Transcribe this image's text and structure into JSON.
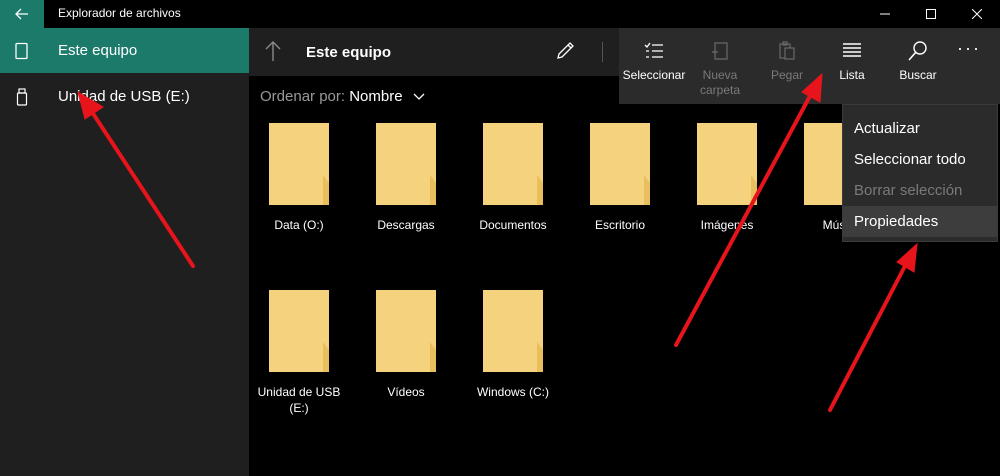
{
  "window": {
    "title": "Explorador de archivos",
    "controls": [
      "minimize",
      "maximize",
      "close"
    ]
  },
  "sidebar": {
    "items": [
      {
        "label": "Este equipo",
        "icon": "device-icon",
        "active": true
      },
      {
        "label": "Unidad de USB (E:)",
        "icon": "usb-drive-icon",
        "active": false
      }
    ]
  },
  "toolbar": {
    "location": "Este equipo",
    "commands": [
      {
        "label": "Seleccionar",
        "icon": "select-checklist-icon",
        "enabled": true
      },
      {
        "label": "Nueva carpeta",
        "icon": "new-folder-icon",
        "enabled": false
      },
      {
        "label": "Pegar",
        "icon": "paste-icon",
        "enabled": false
      },
      {
        "label": "Lista",
        "icon": "list-view-icon",
        "enabled": true
      },
      {
        "label": "Buscar",
        "icon": "search-icon",
        "enabled": true
      }
    ],
    "more_label": "···"
  },
  "sort": {
    "label": "Ordenar por:",
    "value": "Nombre"
  },
  "items": [
    {
      "name": "Data (O:)"
    },
    {
      "name": "Descargas"
    },
    {
      "name": "Documentos"
    },
    {
      "name": "Escritorio"
    },
    {
      "name": "Imágenes"
    },
    {
      "name": "Mús"
    },
    {
      "name": "Unidad de USB (E:)"
    },
    {
      "name": "Vídeos"
    },
    {
      "name": "Windows (C:)"
    }
  ],
  "context_menu": {
    "items": [
      {
        "label": "Actualizar",
        "enabled": true
      },
      {
        "label": "Seleccionar todo",
        "enabled": true
      },
      {
        "label": "Borrar selección",
        "enabled": false
      },
      {
        "label": "Propiedades",
        "enabled": true,
        "highlighted": true
      }
    ]
  },
  "colors": {
    "accent": "#1b7a69",
    "folder": "#f5d37e",
    "annotation_arrow": "#e8141b"
  }
}
